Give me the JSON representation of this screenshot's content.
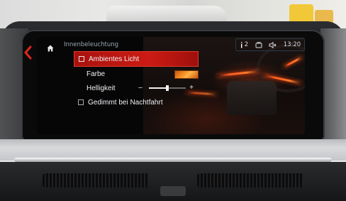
{
  "header": {
    "title": "Innenbeleuchtung",
    "home_icon": "home-icon",
    "status": {
      "notification_count": "2",
      "notification_icon": "info-icon",
      "phone_icon": "phone-icon",
      "mute_icon": "speaker-muted-icon",
      "time": "13:20"
    }
  },
  "menu": {
    "items": [
      {
        "label": "Ambientes Licht",
        "type": "checkbox",
        "selected": true
      },
      {
        "label": "Farbe",
        "type": "color"
      },
      {
        "label": "Helligkeit",
        "type": "slider"
      },
      {
        "label": "Gedimmt bei Nachtfahrt",
        "type": "checkbox"
      }
    ],
    "slider": {
      "minus": "–",
      "plus": "+",
      "level": 0.5
    }
  },
  "colors": {
    "selection": "#cc1b14",
    "ambient": "#ff5a1e",
    "header_text": "#9aa8b8",
    "back_arrow": "#e0261c"
  }
}
